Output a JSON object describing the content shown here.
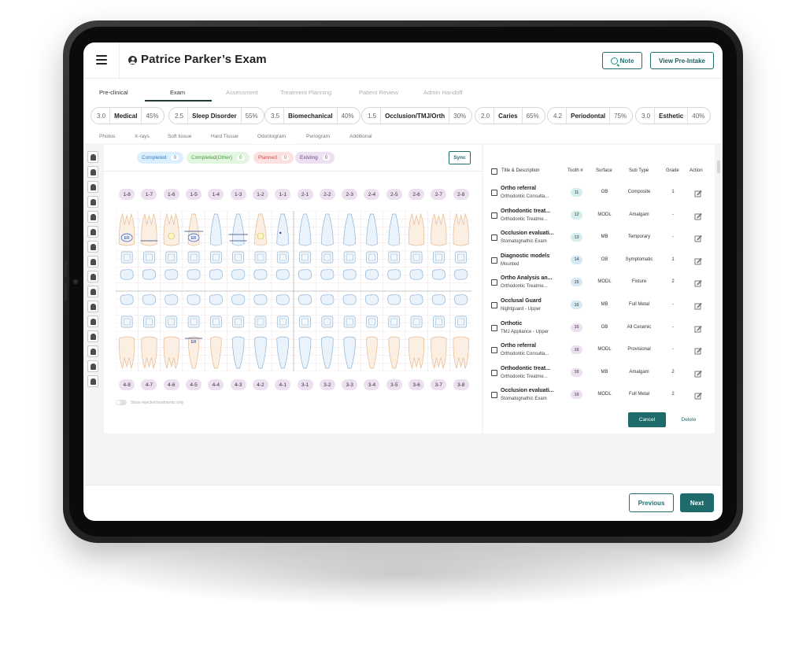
{
  "header": {
    "title": "Patrice Parker’s Exam",
    "note_label": "Note",
    "pre_intake_label": "View Pre-Intake"
  },
  "tabs": [
    "Pre-clinical",
    "Exam",
    "Assessment",
    "Treatment Planning",
    "Patient Review",
    "Admin Handoff"
  ],
  "active_tab": "Exam",
  "scores": [
    {
      "value": "3.0",
      "name": "Medical",
      "percent": "45%"
    },
    {
      "value": "2.5",
      "name": "Sleep Disorder",
      "percent": "55%"
    },
    {
      "value": "3.5",
      "name": "Biomechanical",
      "percent": "40%"
    },
    {
      "value": "1.5",
      "name": "Occlusion/TMJ/Orth",
      "percent": "30%"
    },
    {
      "value": "2.0",
      "name": "Caries",
      "percent": "65%"
    },
    {
      "value": "4.2",
      "name": "Periodontal",
      "percent": "75%"
    },
    {
      "value": "3.0",
      "name": "Esthetic",
      "percent": "40%"
    }
  ],
  "subtabs": [
    "Photos",
    "X-rays",
    "Soft tissue",
    "Hard Tissue",
    "Odontogram",
    "Periogram",
    "Additional"
  ],
  "active_subtab": "Odontogram",
  "legend": [
    {
      "label": "Completed",
      "count": "0",
      "bg": "#dcefff",
      "color": "#3a7bbf"
    },
    {
      "label": "Completed(Other)",
      "count": "0",
      "bg": "#e3f6df",
      "color": "#4a9a44"
    },
    {
      "label": "Planned",
      "count": "0",
      "bg": "#fde1e1",
      "color": "#d24c4c"
    },
    {
      "label": "Existing",
      "count": "0",
      "bg": "#ece0f2",
      "color": "#6b4a80"
    }
  ],
  "sync_label": "Sync",
  "upper_teeth": [
    "1-8",
    "1-7",
    "1-6",
    "1-5",
    "1-4",
    "1-3",
    "1-2",
    "1-1",
    "2-1",
    "2-2",
    "2-3",
    "2-4",
    "2-5",
    "2-6",
    "2-7",
    "2-8"
  ],
  "lower_teeth": [
    "4-8",
    "4-7",
    "4-6",
    "4-5",
    "4-4",
    "4-3",
    "4-2",
    "4-1",
    "3-1",
    "3-2",
    "3-3",
    "3-4",
    "3-5",
    "3-6",
    "3-7",
    "3-8"
  ],
  "tooth_marks": {
    "er": "ER"
  },
  "toggle_label": "Show rejected treatments only",
  "table": {
    "headers": {
      "title": "Title & Description",
      "tooth": "Tooth #",
      "surface": "Surface",
      "subtype": "Sub Type",
      "grade": "Grade",
      "action": "Action"
    },
    "rows": [
      {
        "title": "Ortho referral",
        "desc": "Orthodontic Consulta...",
        "tooth": "11",
        "tooth_bg": "#d4eeee",
        "surface": "OB",
        "subtype": "Composite",
        "grade": "1"
      },
      {
        "title": "Orthodontic treat...",
        "desc": "Orthodontic Treatme...",
        "tooth": "12",
        "tooth_bg": "#d4eeee",
        "surface": "MODL",
        "subtype": "Amalgam",
        "grade": "-"
      },
      {
        "title": "Occlusion evaluati...",
        "desc": "Stomatognathic Exam",
        "tooth": "13",
        "tooth_bg": "#d4eeee",
        "surface": "MB",
        "subtype": "Temporary",
        "grade": "-"
      },
      {
        "title": "Diagnostic models",
        "desc": "Mounted",
        "tooth": "14",
        "tooth_bg": "#d6e8f4",
        "surface": "OB",
        "subtype": "Symptomatic",
        "grade": "1"
      },
      {
        "title": "Ortho Analysis an...",
        "desc": "Orthodontic Treatme...",
        "tooth": "15",
        "tooth_bg": "#d6e8f4",
        "surface": "MODL",
        "subtype": "Fixture",
        "grade": "2"
      },
      {
        "title": "Occlusal Guard",
        "desc": "Nightguard - Upper",
        "tooth": "16",
        "tooth_bg": "#d6e8f4",
        "surface": "MB",
        "subtype": "Full Metal",
        "grade": "-"
      },
      {
        "title": "Orthotic",
        "desc": "TMJ Appliance - Upper",
        "tooth": "16",
        "tooth_bg": "#ecdff0",
        "surface": "OB",
        "subtype": "All Ceramic",
        "grade": "-"
      },
      {
        "title": "Ortho referral",
        "desc": "Orthodontic Consulta...",
        "tooth": "16",
        "tooth_bg": "#ecdff0",
        "surface": "MODL",
        "subtype": "Provisional",
        "grade": "-"
      },
      {
        "title": "Orthodontic treat...",
        "desc": "Orthodontic Treatme...",
        "tooth": "16",
        "tooth_bg": "#ecdff0",
        "surface": "MB",
        "subtype": "Amalgam",
        "grade": "2"
      },
      {
        "title": "Occlusion evaluati...",
        "desc": "Stomatognathic Exam",
        "tooth": "16",
        "tooth_bg": "#ecdff0",
        "surface": "MODL",
        "subtype": "Full Metal",
        "grade": "2"
      }
    ]
  },
  "cancel_label": "Cancel",
  "delete_label": "Delete",
  "previous_label": "Previous",
  "next_label": "Next",
  "colors": {
    "accent": "#1f6b6b",
    "tooth_fill": "#fbeee2",
    "tooth_line": "#e8b98e",
    "box_line": "#8fb3d6"
  }
}
